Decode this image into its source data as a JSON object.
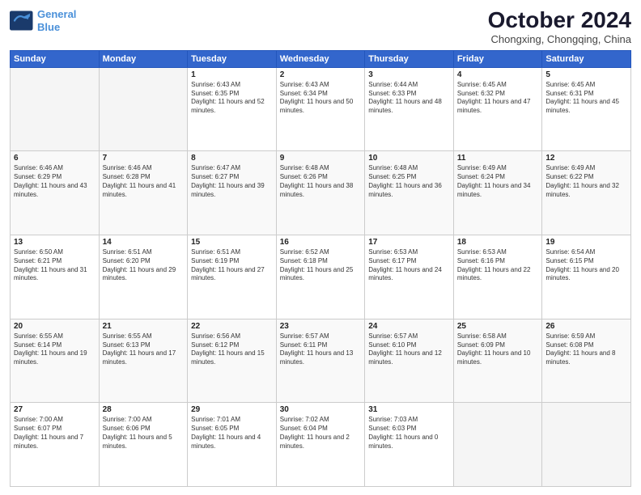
{
  "logo": {
    "line1": "General",
    "line2": "Blue"
  },
  "header": {
    "month": "October 2024",
    "location": "Chongxing, Chongqing, China"
  },
  "days_of_week": [
    "Sunday",
    "Monday",
    "Tuesday",
    "Wednesday",
    "Thursday",
    "Friday",
    "Saturday"
  ],
  "weeks": [
    [
      {
        "day": "",
        "empty": true
      },
      {
        "day": "",
        "empty": true
      },
      {
        "day": "1",
        "rise": "6:43 AM",
        "set": "6:35 PM",
        "daylight": "11 hours and 52 minutes."
      },
      {
        "day": "2",
        "rise": "6:43 AM",
        "set": "6:34 PM",
        "daylight": "11 hours and 50 minutes."
      },
      {
        "day": "3",
        "rise": "6:44 AM",
        "set": "6:33 PM",
        "daylight": "11 hours and 48 minutes."
      },
      {
        "day": "4",
        "rise": "6:45 AM",
        "set": "6:32 PM",
        "daylight": "11 hours and 47 minutes."
      },
      {
        "day": "5",
        "rise": "6:45 AM",
        "set": "6:31 PM",
        "daylight": "11 hours and 45 minutes."
      }
    ],
    [
      {
        "day": "6",
        "rise": "6:46 AM",
        "set": "6:29 PM",
        "daylight": "11 hours and 43 minutes."
      },
      {
        "day": "7",
        "rise": "6:46 AM",
        "set": "6:28 PM",
        "daylight": "11 hours and 41 minutes."
      },
      {
        "day": "8",
        "rise": "6:47 AM",
        "set": "6:27 PM",
        "daylight": "11 hours and 39 minutes."
      },
      {
        "day": "9",
        "rise": "6:48 AM",
        "set": "6:26 PM",
        "daylight": "11 hours and 38 minutes."
      },
      {
        "day": "10",
        "rise": "6:48 AM",
        "set": "6:25 PM",
        "daylight": "11 hours and 36 minutes."
      },
      {
        "day": "11",
        "rise": "6:49 AM",
        "set": "6:24 PM",
        "daylight": "11 hours and 34 minutes."
      },
      {
        "day": "12",
        "rise": "6:49 AM",
        "set": "6:22 PM",
        "daylight": "11 hours and 32 minutes."
      }
    ],
    [
      {
        "day": "13",
        "rise": "6:50 AM",
        "set": "6:21 PM",
        "daylight": "11 hours and 31 minutes."
      },
      {
        "day": "14",
        "rise": "6:51 AM",
        "set": "6:20 PM",
        "daylight": "11 hours and 29 minutes."
      },
      {
        "day": "15",
        "rise": "6:51 AM",
        "set": "6:19 PM",
        "daylight": "11 hours and 27 minutes."
      },
      {
        "day": "16",
        "rise": "6:52 AM",
        "set": "6:18 PM",
        "daylight": "11 hours and 25 minutes."
      },
      {
        "day": "17",
        "rise": "6:53 AM",
        "set": "6:17 PM",
        "daylight": "11 hours and 24 minutes."
      },
      {
        "day": "18",
        "rise": "6:53 AM",
        "set": "6:16 PM",
        "daylight": "11 hours and 22 minutes."
      },
      {
        "day": "19",
        "rise": "6:54 AM",
        "set": "6:15 PM",
        "daylight": "11 hours and 20 minutes."
      }
    ],
    [
      {
        "day": "20",
        "rise": "6:55 AM",
        "set": "6:14 PM",
        "daylight": "11 hours and 19 minutes."
      },
      {
        "day": "21",
        "rise": "6:55 AM",
        "set": "6:13 PM",
        "daylight": "11 hours and 17 minutes."
      },
      {
        "day": "22",
        "rise": "6:56 AM",
        "set": "6:12 PM",
        "daylight": "11 hours and 15 minutes."
      },
      {
        "day": "23",
        "rise": "6:57 AM",
        "set": "6:11 PM",
        "daylight": "11 hours and 13 minutes."
      },
      {
        "day": "24",
        "rise": "6:57 AM",
        "set": "6:10 PM",
        "daylight": "11 hours and 12 minutes."
      },
      {
        "day": "25",
        "rise": "6:58 AM",
        "set": "6:09 PM",
        "daylight": "11 hours and 10 minutes."
      },
      {
        "day": "26",
        "rise": "6:59 AM",
        "set": "6:08 PM",
        "daylight": "11 hours and 8 minutes."
      }
    ],
    [
      {
        "day": "27",
        "rise": "7:00 AM",
        "set": "6:07 PM",
        "daylight": "11 hours and 7 minutes."
      },
      {
        "day": "28",
        "rise": "7:00 AM",
        "set": "6:06 PM",
        "daylight": "11 hours and 5 minutes."
      },
      {
        "day": "29",
        "rise": "7:01 AM",
        "set": "6:05 PM",
        "daylight": "11 hours and 4 minutes."
      },
      {
        "day": "30",
        "rise": "7:02 AM",
        "set": "6:04 PM",
        "daylight": "11 hours and 2 minutes."
      },
      {
        "day": "31",
        "rise": "7:03 AM",
        "set": "6:03 PM",
        "daylight": "11 hours and 0 minutes."
      },
      {
        "day": "",
        "empty": true
      },
      {
        "day": "",
        "empty": true
      }
    ]
  ]
}
